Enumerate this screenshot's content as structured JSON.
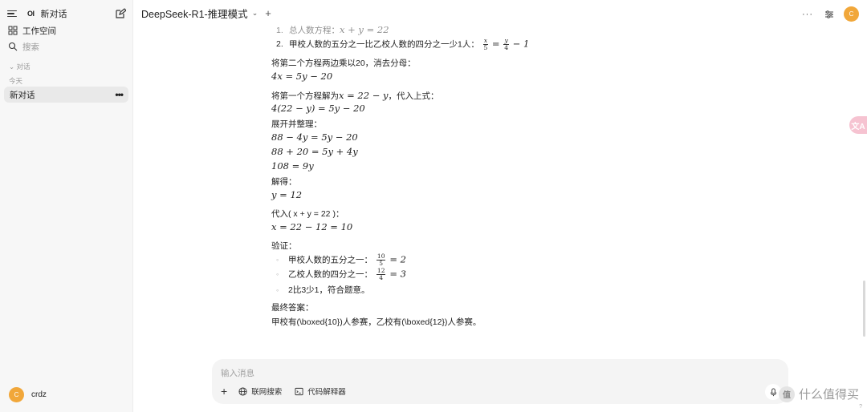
{
  "sidebar": {
    "logo": "OI",
    "new_chat": "新对话",
    "workspace": "工作空间",
    "search": "搜索",
    "section_label": "对话",
    "today_label": "今天",
    "active_chat": "新对话",
    "user_initial": "C",
    "user_name": "crdz"
  },
  "header": {
    "model_name": "DeepSeek-R1-推理模式",
    "avatar_initial": "C"
  },
  "message": {
    "eq1_label": "总人数方程：",
    "eq1_math": "x + y = 22",
    "eq2_label": "甲校人数的五分之一比乙校人数的四分之一少1人：",
    "eq2_frac1_num": "x",
    "eq2_frac1_den": "5",
    "eq2_eq": "=",
    "eq2_frac2_num": "y",
    "eq2_frac2_den": "4",
    "eq2_tail": "− 1",
    "step1": "将第二个方程两边乘以20，消去分母：",
    "step1_math": "4x = 5y − 20",
    "step2": "将第一个方程解为",
    "step2_math": "x = 22 − y",
    "step2_tail": "，代入上式：",
    "step2_result": "4(22 − y) = 5y − 20",
    "step3": "展开并整理：",
    "step3_m1": "88 − 4y = 5y − 20",
    "step3_m2": "88 + 20 = 5y + 4y",
    "step3_m3": "108 = 9y",
    "step4": "解得：",
    "step4_math": "y = 12",
    "step5": "代入( x + y = 22 )：",
    "step5_math": "x = 22 − 12 = 10",
    "verify": "验证：",
    "v1_label": "甲校人数的五分之一：",
    "v1_num": "10",
    "v1_den": "5",
    "v1_tail": "= 2",
    "v2_label": "乙校人数的四分之一：",
    "v2_num": "12",
    "v2_den": "4",
    "v2_tail": "= 3",
    "v3": "2比3少1，符合题意。",
    "final_label": "最终答案：",
    "final_text": "甲校有(\\boxed{10})人参赛，乙校有(\\boxed{12})人参赛。"
  },
  "composer": {
    "placeholder": "输入消息",
    "web_search": "联网搜索",
    "code_interpreter": "代码解释器"
  },
  "watermark": {
    "badge": "值",
    "text": "什么值得买"
  },
  "misc": {
    "translate_badge": "文A",
    "help": "?"
  }
}
